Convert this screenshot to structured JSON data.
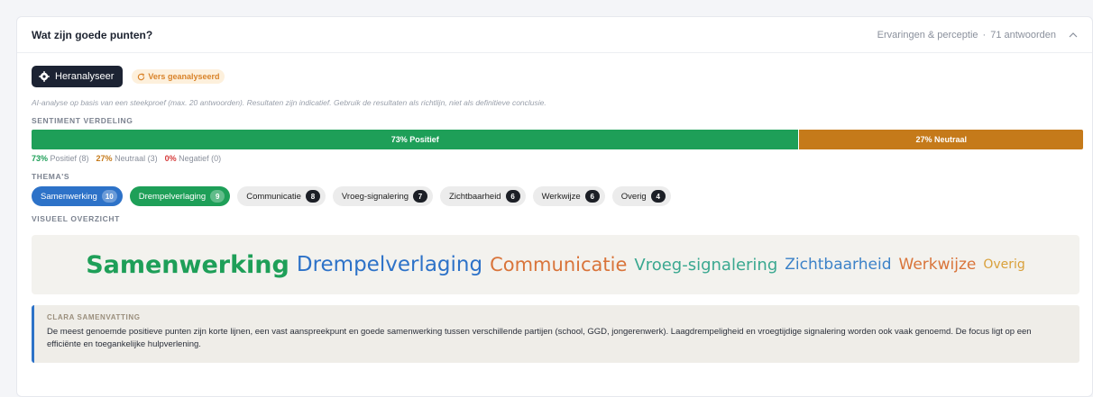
{
  "card": {
    "question": "Wat zijn goede punten?",
    "category": "Ervaringen & perceptie",
    "separator": "·",
    "responses": "71 antwoorden"
  },
  "actions": {
    "reanalyze_label": "Heranalyseer",
    "fresh_badge": "Vers geanalyseerd"
  },
  "disclaimer": "AI-analyse op basis van een steekproef (max. 20 antwoorden). Resultaten zijn indicatief. Gebruik de resultaten als richtlijn, niet als definitieve conclusie.",
  "sentiment": {
    "label": "SENTIMENT VERDELING",
    "positive_pct": 73,
    "neutral_pct": 27,
    "negative_pct": 0,
    "positive_bar": "73% Positief",
    "neutral_bar": "27% Neutraal",
    "legend": {
      "pos_pct": "73%",
      "pos_text": "Positief (8)",
      "neu_pct": "27%",
      "neu_text": "Neutraal (3)",
      "neg_pct": "0%",
      "neg_text": "Negatief (0)"
    },
    "colors": {
      "positive": "#1e9f58",
      "neutral": "#c57a1a",
      "negative": "#d63b3b"
    }
  },
  "themes": {
    "label": "THEMA'S",
    "items": [
      {
        "name": "Samenwerking",
        "count": "10"
      },
      {
        "name": "Drempelverlaging",
        "count": "9"
      },
      {
        "name": "Communicatie",
        "count": "8"
      },
      {
        "name": "Vroeg-signalering",
        "count": "7"
      },
      {
        "name": "Zichtbaarheid",
        "count": "6"
      },
      {
        "name": "Werkwijze",
        "count": "6"
      },
      {
        "name": "Overig",
        "count": "4"
      }
    ]
  },
  "visual": {
    "label": "VISUEEL OVERZICHT",
    "words": [
      "Samenwerking",
      "Drempelverlaging",
      "Communicatie",
      "Vroeg-signalering",
      "Zichtbaarheid",
      "Werkwijze",
      "Overig"
    ]
  },
  "summary": {
    "label": "CLARA SAMENVATTING",
    "text": "De meest genoemde positieve punten zijn korte lijnen, een vast aanspreekpunt en goede samenwerking tussen verschillende partijen (school, GGD, jongerenwerk). Laagdrempeligheid en vroegtijdige signalering worden ook vaak genoemd. De focus ligt op een efficiënte en toegankelijke hulpverlening."
  },
  "icons": {
    "reanalyze": "gear-icon",
    "fresh": "refresh-icon",
    "collapse": "chevron-up-icon"
  }
}
